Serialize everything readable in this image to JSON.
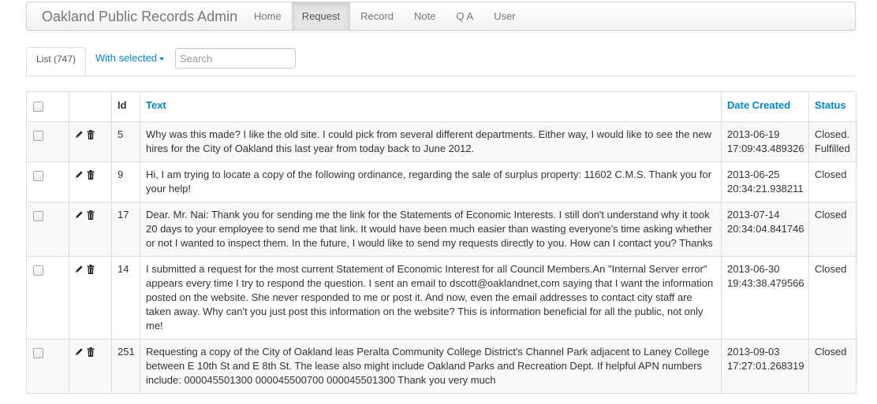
{
  "navbar": {
    "brand": "Oakland Public Records Admin",
    "links": [
      "Home",
      "Request",
      "Record",
      "Note",
      "Q A",
      "User"
    ],
    "active": "Request"
  },
  "toolbar": {
    "list_tab": "List (747)",
    "with_selected": "With selected",
    "search_placeholder": "Search"
  },
  "table": {
    "headers": {
      "id": "Id",
      "text": "Text",
      "date_created": "Date Created",
      "status": "Status"
    },
    "rows": [
      {
        "id": "5",
        "text": "Why was this made? I like the old site. I could pick from several different departments. Either way, I would like to see the new hires for the City of Oakland this last year from today back to June 2012.",
        "date": "2013-06-19 17:09:43.489326",
        "status": "Closed. Fulfilled"
      },
      {
        "id": "9",
        "text": "Hi, I am trying to locate a copy of the following ordinance, regarding the sale of surplus property: 11602 C.M.S. Thank you for your help!",
        "date": "2013-06-25 20:34:21.938211",
        "status": "Closed"
      },
      {
        "id": "17",
        "text": "Dear. Mr. Nai: Thank you for sending me the link for the Statements of Economic Interests. I still don't understand why it took 20 days to your employee to send me that link. It would have been much easier than wasting everyone's time asking whether or not I wanted to inspect them. In the future, I would like to send my requests directly to you. How can I contact you? Thanks",
        "date": "2013-07-14 20:34:04.841746",
        "status": "Closed"
      },
      {
        "id": "14",
        "text": "I submitted a request for the most current Statement of Economic Interest for all Council Members.An \"Internal Server error\" appears every time I try to respond the question. I sent an email to dscott@oaklandnet,com saying that I want the information posted on the website. She never responded to me or post it. And now, even the email addresses to contact city staff are taken away. Why can't you just post this information on the website? This is information beneficial for all the public, not only me!",
        "date": "2013-06-30 19:43:38.479566",
        "status": "Closed"
      },
      {
        "id": "251",
        "text": "Requesting a copy of the City of Oakland leas Peralta Community College District's Channel Park adjacent to Laney College between E 10th St and E 8th St. The lease also might include Oakland Parks and Recreation Dept. If helpful APN numbers include: 000045501300 000045500700 000045501300 Thank you very much",
        "date": "2013-09-03 17:27:01.268319",
        "status": "Closed"
      }
    ]
  }
}
